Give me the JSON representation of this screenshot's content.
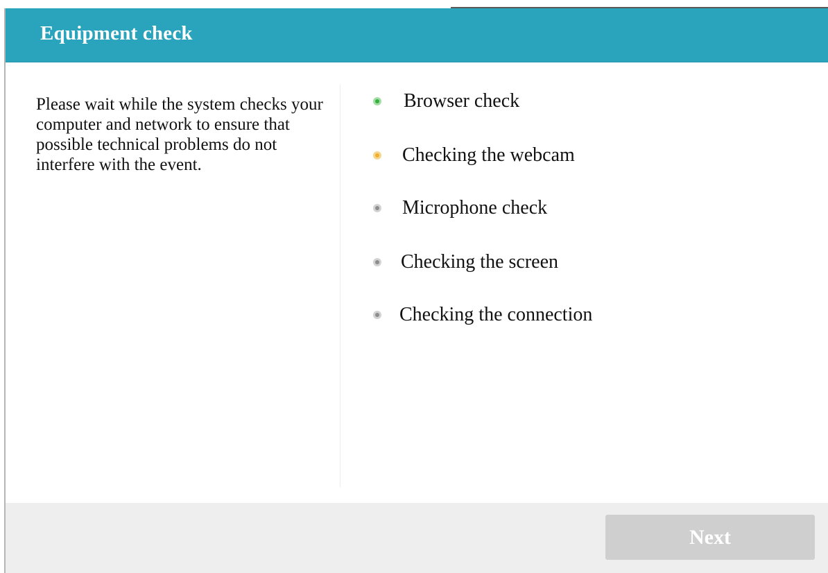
{
  "dialog": {
    "title": "Equipment check",
    "description": "Please wait while the system checks your computer and network to ensure that possible technical problems do not interfere with the event.",
    "checks": [
      {
        "label": "Browser check",
        "status": "passed",
        "color": "#34b13c"
      },
      {
        "label": "Checking the webcam",
        "status": "in-progress",
        "color": "#eeb02d"
      },
      {
        "label": "Microphone check",
        "status": "pending",
        "color": "#8d8d8d"
      },
      {
        "label": "Checking the screen",
        "status": "pending",
        "color": "#8d8d8d"
      },
      {
        "label": "Checking the connection",
        "status": "pending",
        "color": "#8d8d8d"
      }
    ],
    "next_label": "Next",
    "next_enabled": false
  },
  "colors": {
    "header_background": "#2aa3bd",
    "footer_background": "#eeeeee",
    "button_disabled": "#cfcfcf"
  }
}
